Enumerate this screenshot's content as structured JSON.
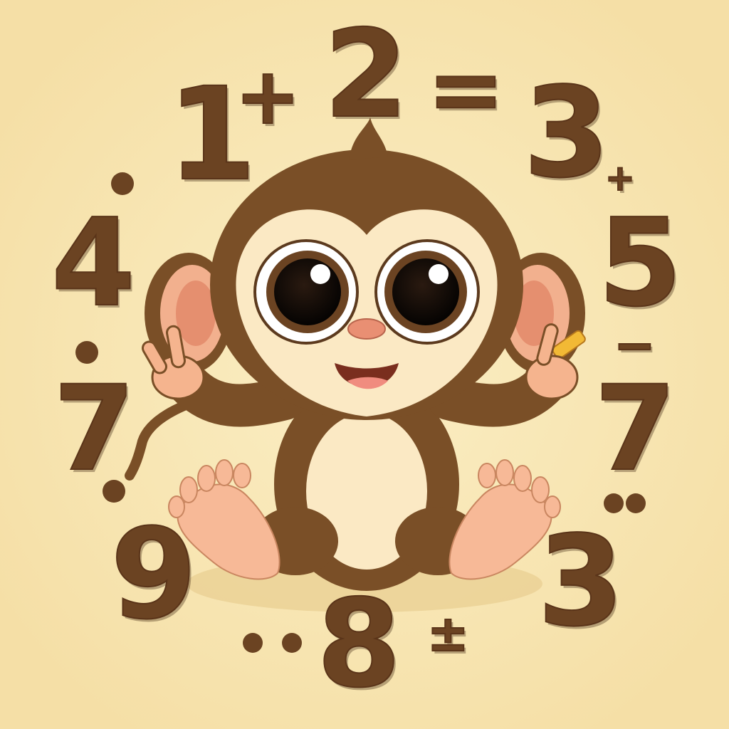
{
  "image": {
    "background_color": "#f8e6b3",
    "numeral_color": "#6b4322",
    "monkey_fur_color": "#7a4f27",
    "monkey_face_color": "#fbe9c4"
  },
  "glyphs": {
    "one": "1",
    "plus_top": "+",
    "two": "2",
    "equals": "=",
    "three_top": "3",
    "plus_small": "+",
    "four": "4",
    "five": "5",
    "seven_left": "7",
    "seven_right": "7",
    "minus_right": "−",
    "nine": "9",
    "eight": "8",
    "three_bottom": "3",
    "minus_bottom": "±"
  }
}
